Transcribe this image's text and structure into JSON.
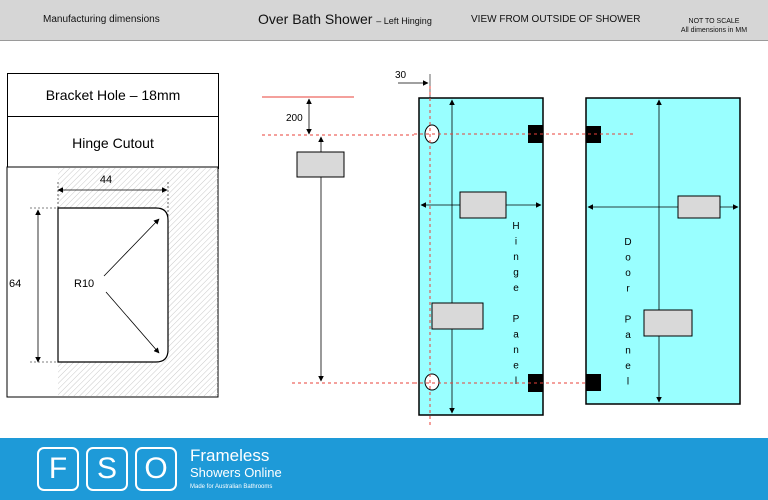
{
  "header": {
    "left": "Manufacturing dimensions",
    "title": "Over Bath Shower",
    "title_sub": "– Left Hinging",
    "view": "VIEW FROM OUTSIDE OF SHOWER",
    "scale": "NOT TO SCALE",
    "units": "All dimensions in MM"
  },
  "detail": {
    "bracket_hole": "Bracket Hole – 18mm",
    "hinge_cutout": "Hinge Cutout",
    "width_label": "44",
    "height_label": "64",
    "radius_label": "R10"
  },
  "elevation": {
    "offset_top": "200",
    "offset_edge": "30",
    "hinge_panel": [
      "H",
      "i",
      "n",
      "g",
      "e",
      "",
      "P",
      "a",
      "n",
      "e",
      "l"
    ],
    "door_panel": [
      "D",
      "o",
      "o",
      "r",
      "",
      "P",
      "a",
      "n",
      "e",
      "l"
    ]
  },
  "colors": {
    "glass": "#99ffff",
    "footer": "#1e9ad8",
    "red_dashed": "#e8403a"
  },
  "footer": {
    "logo": [
      "F",
      "S",
      "O"
    ],
    "brand_line1": "Frameless",
    "brand_line2": "Showers Online",
    "brand_line3": "Made for Australian Bathrooms"
  }
}
